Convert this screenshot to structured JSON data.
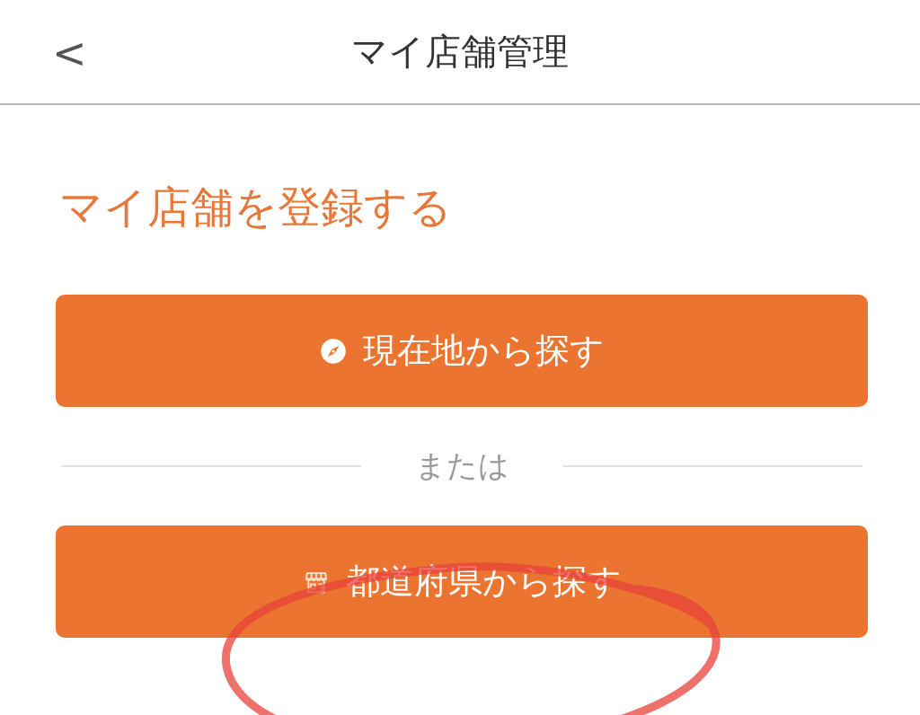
{
  "header": {
    "back": "<",
    "title": "マイ店舗管理"
  },
  "heading": "マイ店舗を登録する",
  "buttons": [
    {
      "kind": "location",
      "label": "現在地から探す"
    },
    {
      "kind": "store",
      "label": "都道府県から探す"
    }
  ],
  "separator": "または"
}
